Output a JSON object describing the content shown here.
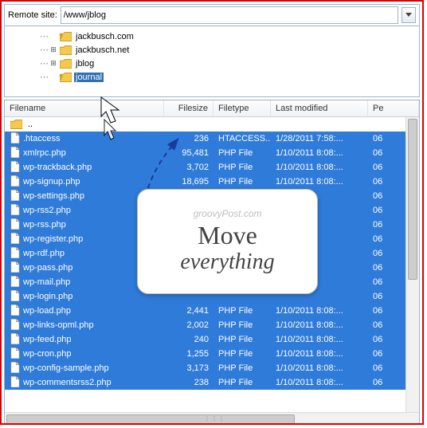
{
  "remote": {
    "label": "Remote site:",
    "path": "/www/jblog"
  },
  "tree": {
    "items": [
      {
        "label": "jackbusch.com",
        "hasQmark": true,
        "indent": 1,
        "expander": "none"
      },
      {
        "label": "jackbusch.net",
        "hasQmark": false,
        "indent": 1,
        "expander": "plus"
      },
      {
        "label": "jblog",
        "hasQmark": false,
        "indent": 1,
        "expander": "plus"
      },
      {
        "label": "journal",
        "hasQmark": true,
        "indent": 1,
        "expander": "none",
        "selected": true
      }
    ]
  },
  "columns": {
    "name": "Filename",
    "size": "Filesize",
    "type": "Filetype",
    "mod": "Last modified",
    "perm": "Pe"
  },
  "parent_label": "..",
  "files": [
    {
      "name": ".htaccess",
      "size": "236",
      "type": "HTACCESS...",
      "mod": "1/28/2011 7:58:...",
      "perm": "06"
    },
    {
      "name": "xmlrpc.php",
      "size": "95,481",
      "type": "PHP File",
      "mod": "1/10/2011 8:08:...",
      "perm": "06"
    },
    {
      "name": "wp-trackback.php",
      "size": "3,702",
      "type": "PHP File",
      "mod": "1/10/2011 8:08:...",
      "perm": "06"
    },
    {
      "name": "wp-signup.php",
      "size": "18,695",
      "type": "PHP File",
      "mod": "1/10/2011 8:08:...",
      "perm": "06"
    },
    {
      "name": "wp-settings.php",
      "size": "",
      "type": "",
      "mod": "",
      "perm": "06"
    },
    {
      "name": "wp-rss2.php",
      "size": "",
      "type": "",
      "mod": "",
      "perm": "06"
    },
    {
      "name": "wp-rss.php",
      "size": "",
      "type": "",
      "mod": "",
      "perm": "06"
    },
    {
      "name": "wp-register.php",
      "size": "",
      "type": "",
      "mod": "",
      "perm": "06"
    },
    {
      "name": "wp-rdf.php",
      "size": "",
      "type": "",
      "mod": "",
      "perm": "06"
    },
    {
      "name": "wp-pass.php",
      "size": "",
      "type": "",
      "mod": "",
      "perm": "06"
    },
    {
      "name": "wp-mail.php",
      "size": "",
      "type": "",
      "mod": "",
      "perm": "06"
    },
    {
      "name": "wp-login.php",
      "size": "",
      "type": "",
      "mod": "",
      "perm": "06"
    },
    {
      "name": "wp-load.php",
      "size": "2,441",
      "type": "PHP File",
      "mod": "1/10/2011 8:08:...",
      "perm": "06"
    },
    {
      "name": "wp-links-opml.php",
      "size": "2,002",
      "type": "PHP File",
      "mod": "1/10/2011 8:08:...",
      "perm": "06"
    },
    {
      "name": "wp-feed.php",
      "size": "240",
      "type": "PHP File",
      "mod": "1/10/2011 8:08:...",
      "perm": "06"
    },
    {
      "name": "wp-cron.php",
      "size": "1,255",
      "type": "PHP File",
      "mod": "1/10/2011 8:08:...",
      "perm": "06"
    },
    {
      "name": "wp-config-sample.php",
      "size": "3,173",
      "type": "PHP File",
      "mod": "1/10/2011 8:08:...",
      "perm": "06"
    },
    {
      "name": "wp-commentsrss2.php",
      "size": "238",
      "type": "PHP File",
      "mod": "1/10/2011 8:08:...",
      "perm": "06"
    }
  ],
  "annotation": {
    "brand": "groovyPost.com",
    "line1": "Move",
    "line2": "everything"
  }
}
